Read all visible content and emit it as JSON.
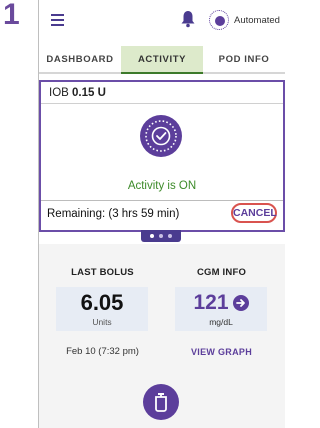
{
  "step": {
    "number": "1"
  },
  "topbar": {
    "mode_label": "Automated"
  },
  "tabs": [
    {
      "label": "DASHBOARD"
    },
    {
      "label": "ACTIVITY",
      "active": true
    },
    {
      "label": "POD INFO"
    }
  ],
  "activity": {
    "iob_label": "IOB",
    "iob_value": "0.15 U",
    "status": "Activity is ON",
    "remaining": "Remaining: (3 hrs 59 min)",
    "cancel_label": "CANCEL"
  },
  "pager": {
    "pages": 3,
    "current": 1
  },
  "last_bolus": {
    "title": "LAST BOLUS",
    "value": "6.05",
    "unit": "Units",
    "time": "Feb 10 (7:32 pm)"
  },
  "cgm": {
    "title": "CGM INFO",
    "value": "121",
    "unit": "mg/dL",
    "link": "VIEW GRAPH"
  },
  "colors": {
    "accent": "#5c3e9b",
    "active_tab_bg": "#ddeacb",
    "status_green": "#3d8b2a",
    "highlight_red": "#d9534f"
  },
  "icons": [
    "menu-icon",
    "bell-icon",
    "automated-mode-icon",
    "activity-check-icon",
    "trend-arrow-icon",
    "bolus-icon"
  ]
}
